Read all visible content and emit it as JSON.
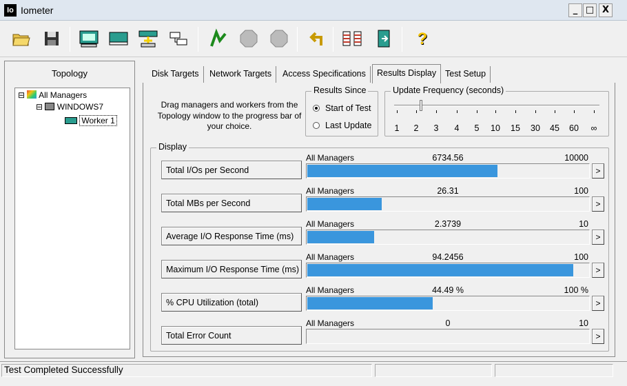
{
  "window": {
    "app_icon": "Io",
    "title": "Iometer"
  },
  "window_controls": {
    "minimize": "_",
    "maximize": "□",
    "close": "X"
  },
  "toolbar": {
    "buttons": [
      {
        "name": "open-folder-icon"
      },
      {
        "name": "save-icon"
      },
      {
        "name": "new-disk-worker-icon"
      },
      {
        "name": "new-network-worker-icon"
      },
      {
        "name": "duplicate-worker-icon"
      },
      {
        "name": "disconnect-icon"
      },
      {
        "name": "start-tests-icon",
        "label": "GO"
      },
      {
        "name": "stop-current-test-icon",
        "label": "STOP"
      },
      {
        "name": "stop-all-tests-icon",
        "label": "STOP ALL"
      },
      {
        "name": "reset-workers-icon"
      },
      {
        "name": "exit-icon"
      },
      {
        "name": "help-icon",
        "label": "?"
      }
    ]
  },
  "topology": {
    "title": "Topology",
    "tree": [
      {
        "label": "All Managers",
        "expander": "⊟",
        "level": 0
      },
      {
        "label": "WINDOWS7",
        "expander": "⊟",
        "level": 1
      },
      {
        "label": "Worker 1",
        "level": 2
      }
    ]
  },
  "tabs": [
    {
      "label": "Disk Targets",
      "active": false
    },
    {
      "label": "Network Targets",
      "active": false
    },
    {
      "label": "Access Specifications",
      "active": false
    },
    {
      "label": "Results Display",
      "active": true
    },
    {
      "label": "Test Setup",
      "active": false
    }
  ],
  "results": {
    "instructions": "Drag managers and workers from the Topology window to the progress bar of your choice.",
    "since": {
      "label": "Results Since",
      "options": [
        {
          "label": "Start of Test",
          "selected": true
        },
        {
          "label": "Last Update",
          "selected": false
        }
      ]
    },
    "update_frequency": {
      "label": "Update Frequency (seconds)",
      "ticks": [
        "1",
        "2",
        "3",
        "4",
        "5",
        "10",
        "15",
        "30",
        "45",
        "60",
        "∞"
      ],
      "selected": "2"
    },
    "display": {
      "label": "Display",
      "metrics": [
        {
          "name": "Total I/Os per Second",
          "target": "All Managers",
          "value": "6734.56",
          "max": "10000",
          "fraction": 0.6735
        },
        {
          "name": "Total MBs per Second",
          "target": "All Managers",
          "value": "26.31",
          "max": "100",
          "fraction": 0.2631
        },
        {
          "name": "Average I/O Response Time (ms)",
          "target": "All Managers",
          "value": "2.3739",
          "max": "10",
          "fraction": 0.2374
        },
        {
          "name": "Maximum I/O Response Time (ms)",
          "target": "All Managers",
          "value": "94.2456",
          "max": "100",
          "fraction": 0.9425
        },
        {
          "name": "% CPU Utilization (total)",
          "target": "All Managers",
          "value": "44.49 %",
          "max": "100 %",
          "fraction": 0.4449
        },
        {
          "name": "Total Error Count",
          "target": "All Managers",
          "value": "0",
          "max": "10",
          "fraction": 0
        }
      ],
      "more_button": ">"
    }
  },
  "status": {
    "text": "Test Completed Successfully"
  },
  "colors": {
    "bar_fill": "#3a96dd",
    "titlebar": "#dfe7f0"
  }
}
